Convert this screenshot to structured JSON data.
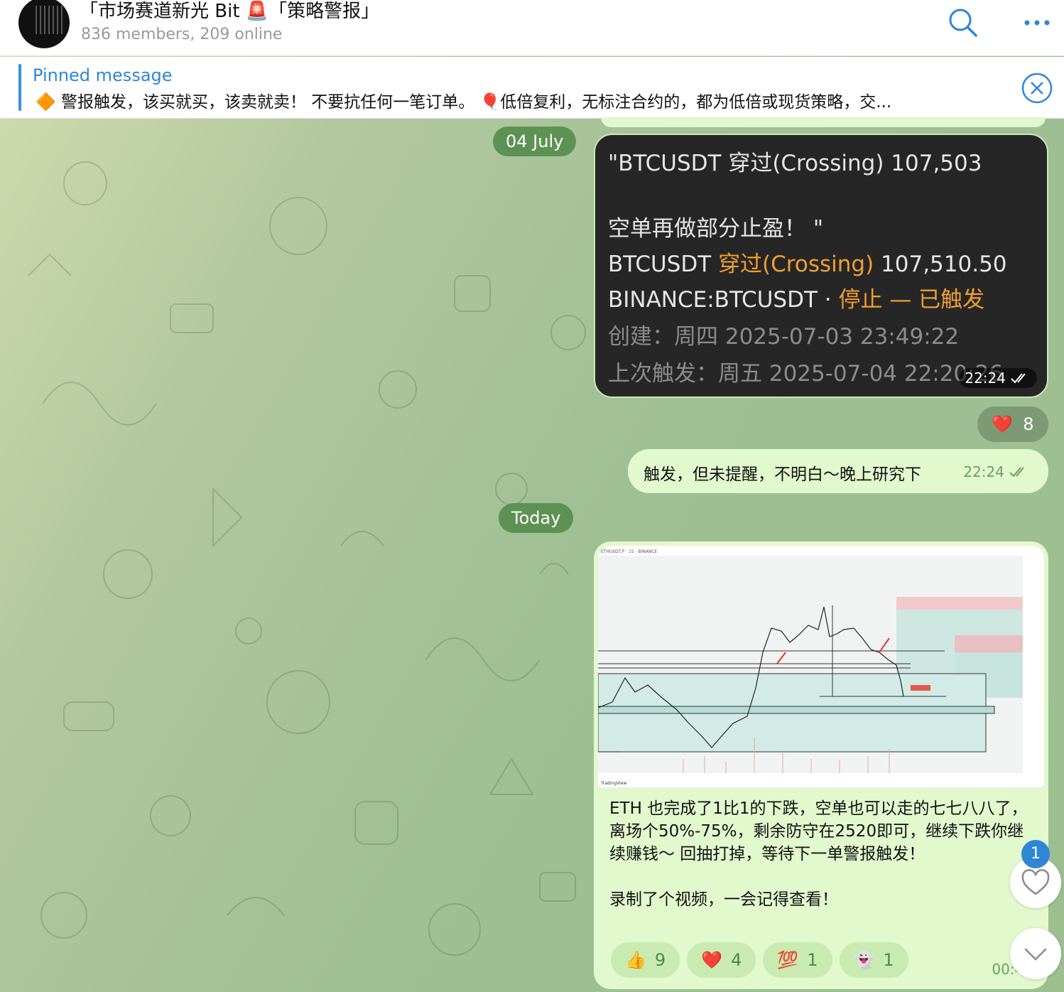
{
  "header": {
    "title": "「市场赛道新光 Bit 🚨「策略警报」",
    "subtitle": "836 members, 209 online"
  },
  "pinned": {
    "label": "Pinned message",
    "text": "🔶 警报触发，该买就买，该卖就卖！ 不要抗任何一笔订单。 🎈低倍复利，无标注合约的，都为低倍或现货策略，交..."
  },
  "dates": {
    "first": "04 July",
    "second": "Today"
  },
  "alert_message": {
    "line1": "\"BTCUSDT 穿过(Crossing) 107,503",
    "line2": "空单再做部分止盈！ \"",
    "line3_a": "BTCUSDT ",
    "line3_b": "穿过(Crossing)",
    "line3_c": " 107,510.50",
    "line4_a": "BINANCE:BTCUSDT · ",
    "line4_b": "停止 — 已触发",
    "line5": "创建：周四 2025-07-03   23:49:22",
    "line6": "上次触发：周五 2025-07-04   22:20:26",
    "time": "22:24"
  },
  "heart_reaction": {
    "emoji": "❤️",
    "count": "8"
  },
  "reply_message": {
    "text": "触发，但未提醒，不明白～晚上研究下",
    "time": "22:24"
  },
  "eth_message": {
    "chart_header": "ETHUSDT.P · 15 · BINANCE",
    "chart_brand": "TradingView",
    "paragraph1": "ETH 也完成了1比1的下跌，空单也可以走的七七八八了，离场个50%-75%，剩余防守在2520即可，继续下跌你继续赚钱～ 回抽打掉，等待下一单警报触发！",
    "paragraph2": "录制了个视频，一会记得查看！",
    "reactions": [
      {
        "emoji": "👍",
        "count": "9"
      },
      {
        "emoji": "❤️",
        "count": "4"
      },
      {
        "emoji": "💯",
        "count": "1"
      },
      {
        "emoji": "👻",
        "count": "1"
      }
    ],
    "time": "00:40"
  },
  "unread_badge": "1",
  "colors": {
    "accent": "#2f86d6",
    "bubble_out": "#e2f8cd",
    "date_pill": "#5e9254",
    "alert_bg": "#262626",
    "alert_orange": "#f0a030"
  }
}
